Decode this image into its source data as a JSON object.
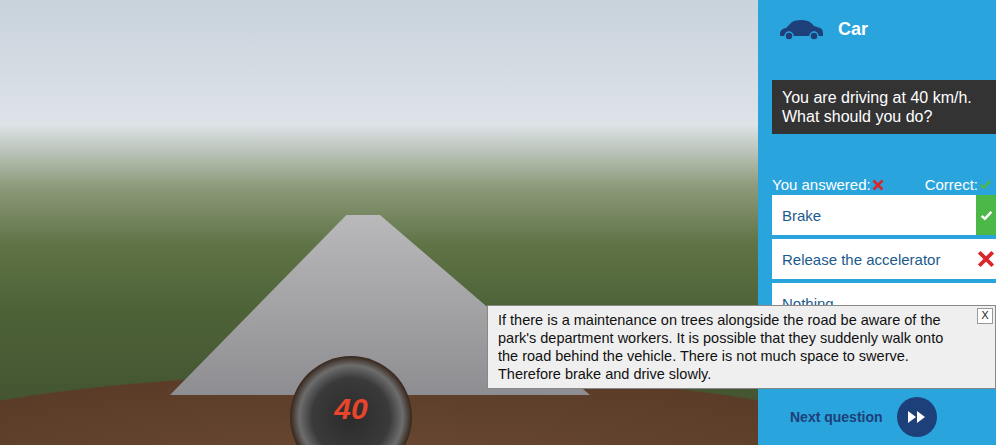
{
  "photo": {
    "speed": "40"
  },
  "panel": {
    "title": "Car"
  },
  "question": "You are driving at 40 km/h.\nWhat should you do?",
  "legend": {
    "answered": "You answered:",
    "correct": "Correct:"
  },
  "options": [
    {
      "label": "Brake",
      "answered": false,
      "correct": true
    },
    {
      "label": "Release the accelerator",
      "answered": true,
      "correct": false
    },
    {
      "label": "Nothing",
      "answered": false,
      "correct": false
    }
  ],
  "tooltip": {
    "text": "If there is a maintenance on trees alongside the road be aware of the park's department workers. It is possible that they suddenly walk onto the road behind the vehicle. There is not much space to swerve. Therefore brake and drive slowly.",
    "close": "X"
  },
  "next": {
    "label": "Next question"
  }
}
